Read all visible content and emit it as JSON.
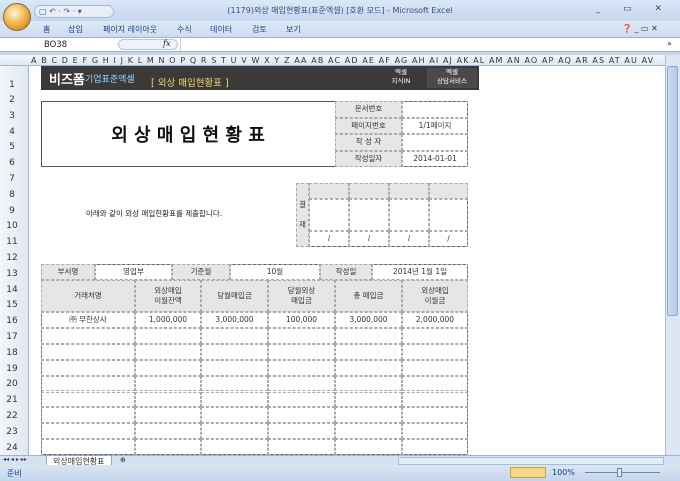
{
  "window": {
    "title": "(1179)외상 매입현황표(표준엑셀) [호환 모드] - Microsoft Excel",
    "qat": "▢ ↶ · ↷ · ▾"
  },
  "ribbon_tabs": [
    "홈",
    "삽입",
    "페이지 레이아웃",
    "수식",
    "데이터",
    "검토",
    "보기"
  ],
  "formula_bar": {
    "name_box": "BO38",
    "fx": "fx",
    "formula": ""
  },
  "columns": "A B C D E F G H I J K L M N O P Q R S T U V W X Y Z AA AB AC AD AE AF AG AH AI AJ AK AL AM AN AO AP AQ AR AS AT AU AV",
  "rows": [
    "1",
    "2",
    "3",
    "4",
    "5",
    "6",
    "7",
    "8",
    "9",
    "10",
    "11",
    "12",
    "13",
    "14",
    "15",
    "16",
    "17",
    "18",
    "19",
    "20",
    "21",
    "22",
    "23",
    "24"
  ],
  "banner": {
    "logo": "비즈폼",
    "brand": "기업표준엑셀",
    "title": "[ 외상 매입현황표 ]",
    "btn1_a": "엑셀",
    "btn1_b": "지식IN",
    "btn2_a": "엑셀",
    "btn2_b": "상담서비스"
  },
  "doc": {
    "title": "외 상 매 입 현 황 표",
    "meta": [
      {
        "label": "문서번호",
        "value": ""
      },
      {
        "label": "페이지번호",
        "value": "1/1페이지"
      },
      {
        "label": "작 성 자",
        "value": ""
      },
      {
        "label": "작성일자",
        "value": "2014-01-01"
      }
    ],
    "intro": "아래와 같이 외상 매입현황표를 제출합니다.",
    "approval": {
      "label_a": "결",
      "label_b": "재",
      "dates": [
        "/",
        "/",
        "/",
        "/"
      ]
    },
    "info": {
      "dept_label": "부서명",
      "dept": "영업부",
      "month_label": "기준월",
      "month": "10월",
      "date_label": "작성일",
      "date": "2014년 1월 1일"
    },
    "headers": [
      [
        "거래처명",
        ""
      ],
      [
        "외상매입",
        "이월잔액"
      ],
      [
        "당월매입금",
        ""
      ],
      [
        "당월외상",
        "매입금"
      ],
      [
        "총 매입금",
        ""
      ],
      [
        "외상매입",
        "이월금"
      ]
    ],
    "rows": [
      [
        "㈜ 무한상사",
        "1,000,000",
        "3,000,000",
        "100,000",
        "3,000,000",
        "2,000,000"
      ]
    ]
  },
  "sheet_tab": "외상매입현황표",
  "status": {
    "ready": "준비",
    "zoom": "100%"
  }
}
